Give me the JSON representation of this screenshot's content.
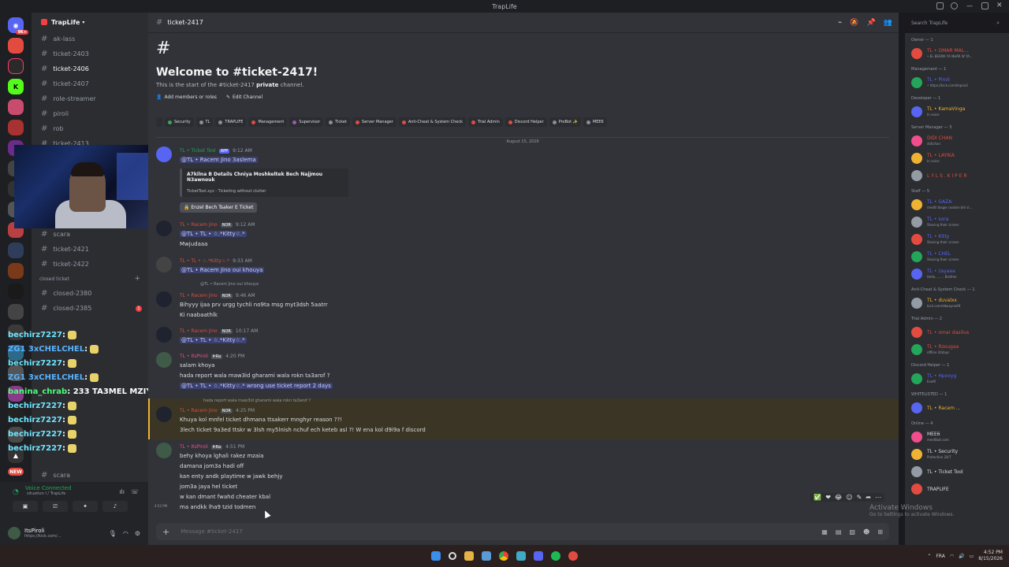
{
  "window": {
    "title": "TrapLife"
  },
  "server": {
    "name": "TrapLife"
  },
  "channels": [
    {
      "name": "ak-lass",
      "active": false,
      "badge": ""
    },
    {
      "name": "ticket-2403",
      "active": false,
      "badge": ""
    },
    {
      "name": "ticket-2406",
      "active": true,
      "badge": ""
    },
    {
      "name": "ticket-2407",
      "active": false,
      "badge": ""
    },
    {
      "name": "role-streamer",
      "active": false,
      "badge": ""
    },
    {
      "name": "piroli",
      "active": false,
      "badge": ""
    },
    {
      "name": "rob",
      "active": false,
      "badge": ""
    },
    {
      "name": "ticket-2413",
      "active": false,
      "badge": ""
    }
  ],
  "channels2": [
    {
      "name": "scara",
      "badge": ""
    },
    {
      "name": "ticket-2421",
      "badge": ""
    },
    {
      "name": "ticket-2422",
      "badge": ""
    }
  ],
  "category_closed": "closed ticket",
  "closed": [
    {
      "name": "closed-2380",
      "badge": ""
    },
    {
      "name": "closed-2385",
      "badge": "1"
    }
  ],
  "channels_bottom": [
    {
      "name": "scara"
    }
  ],
  "guild_badges": {
    "top": "9K+",
    "new": "NEW"
  },
  "stream_chat": [
    {
      "user": "bechirz7227",
      "color": "#6ee6ff",
      "text": ":"
    },
    {
      "user": "ZG1 3xCHELCHEL",
      "color": "#58b4ff",
      "text": ":"
    },
    {
      "user": "bechirz7227",
      "color": "#6ee6ff",
      "text": ":"
    },
    {
      "user": "ZG1 3xCHELCHEL",
      "color": "#58b4ff",
      "text": ":"
    },
    {
      "user": "banina_chrab",
      "color": "#4bff7b",
      "text": ": 233 TA3MEL MZIYA"
    },
    {
      "user": "bechirz7227",
      "color": "#6ee6ff",
      "text": ":"
    },
    {
      "user": "bechirz7227",
      "color": "#6ee6ff",
      "text": ":"
    },
    {
      "user": "bechirz7227",
      "color": "#6ee6ff",
      "text": ":"
    },
    {
      "user": "bechirz7227",
      "color": "#6ee6ff",
      "text": ":"
    }
  ],
  "voice": {
    "title": "Voice Connected",
    "channel": "situation I / TrapLife"
  },
  "user": {
    "name": "ItsPiroli",
    "status": "https://kick.com/..."
  },
  "header": {
    "channel": "ticket-2417",
    "search_placeholder": "Search TrapLife"
  },
  "welcome": {
    "title": "Welcome to #ticket-2417!",
    "sub_prefix": "This is the start of the #ticket-2417 ",
    "sub_private": "private",
    "sub_suffix": " channel.",
    "add_members": "Add members or roles",
    "edit_channel": "Edit Channel"
  },
  "roles": [
    {
      "label": "Security",
      "color": "#3ba55c"
    },
    {
      "label": "TL",
      "color": "#8b8f96"
    },
    {
      "label": "TRAPLIFE",
      "color": "#8b8f96"
    },
    {
      "label": "Management",
      "color": "#e34b40"
    },
    {
      "label": "Supervisor",
      "color": "#9b59b6"
    },
    {
      "label": "Ticket",
      "color": "#8b8f96"
    },
    {
      "label": "Server Manager",
      "color": "#e34b40"
    },
    {
      "label": "Anti-Cheat & System Check",
      "color": "#e34b40"
    },
    {
      "label": "Trial Admin",
      "color": "#e34b40"
    },
    {
      "label": "Discord Helper",
      "color": "#e34b40"
    },
    {
      "label": "ProBot ✨",
      "color": "#8b8f96"
    },
    {
      "label": "MEE6",
      "color": "#8b8f96"
    }
  ],
  "date_divider": "August 15, 2026",
  "messages": [
    {
      "name": "TL • Ticket Tool",
      "tag": "APP",
      "time": "9:12 AM",
      "color": "green",
      "lines": [
        "@TL • Racem Jino 3aslema"
      ]
    },
    {
      "name": "TL • Racem Jino",
      "tag": "NOR",
      "time": "9:12 AM",
      "color": "red",
      "lines": [
        "@TL • TL • ☆.*Kitty☆.*",
        "Mwjudaaa"
      ]
    },
    {
      "name": "TL • TL • ☆.*Kitty☆.*",
      "tag": "",
      "time": "9:33 AM",
      "color": "red",
      "lines": [
        "@TL • Racem Jino oui khouya"
      ]
    },
    {
      "name": "TL • Racem Jino",
      "tag": "NOR",
      "time": "9:46 AM",
      "color": "red",
      "lines": [
        "Bihyyy ijaa prv urgg tychli no9ta msg myt3dsh 5aatrr",
        "Ki naabaathlk"
      ]
    },
    {
      "name": "TL • Racem Jino",
      "tag": "NOR",
      "time": "10:17 AM",
      "color": "red",
      "lines": [
        "@TL • TL • ☆.*Kitty☆.*"
      ]
    },
    {
      "name": "TL • ItsPiroli",
      "tag": "ᐈRa",
      "time": "4:20 PM",
      "color": "pink",
      "lines": [
        "salam khoya",
        "hada report wala maw3id gharami wala rokn ta3arof ?",
        "@TL • TL • ☆.*Kitty☆.* wrong use ticket report 2 days"
      ]
    },
    {
      "name": "TL • Racem Jino",
      "tag": "NOR",
      "time": "4:25 PM",
      "color": "red",
      "lines": [
        "Khuya kol mnfel ticket dhmana ttsakerr mnghyr reason ??!",
        "3lech ticket 9a3ed ttskr  w 3lsh my5lnish nchuf ech keteb asl ?! W ena kol d9i9a f discord"
      ]
    },
    {
      "name": "TL • ItsPiroli",
      "tag": "ᐈRa",
      "time": "4:51 PM",
      "color": "pink",
      "lines": [
        "behy khoya lghali rakez mzaia",
        "damana jom3a hadi off",
        "kan enty andk playtime w jawk behjy",
        "jom3a jaya hel ticket",
        "w kan dmant fwahd cheater kbal",
        "ma andkk lha9 tzid todmen"
      ]
    }
  ],
  "embed": {
    "title": "A7kilna B Details Chniya Moshkeltek Bech Najjmou N3awnouk",
    "footer": "TicketTool.xyz - Ticketing without clutter",
    "button": "Enzel Bech Tsaker E Ticket"
  },
  "reply_previews": [
    "@TL • Racem Jino oui khouya",
    "hada report wala maw3id gharami wala rokn ta3arof ?"
  ],
  "last_time": "4:52 PM",
  "composer_placeholder": "Message #ticket-2417",
  "member_groups": [
    {
      "title": "Owner — 1",
      "members": [
        {
          "name": "TL • OMAR MAL...",
          "status": "• EL BESMA YA NHAR W YA..."
        }
      ]
    },
    {
      "title": "Management — 1",
      "members": [
        {
          "name": "TL • Piroli",
          "status": "• https://kick.com/itspiroli"
        }
      ]
    },
    {
      "title": "Developer — 1",
      "members": [
        {
          "name": "TL • KamaVinga",
          "status": "In voice"
        }
      ]
    },
    {
      "title": "Server Manager — 3",
      "members": [
        {
          "name": "DIDI CHAN",
          "status": "didichan"
        },
        {
          "name": "TL • LAYIKA",
          "status": "In voice"
        },
        {
          "name": "L Y L S . K I P E R",
          "status": ""
        }
      ]
    },
    {
      "title": "Staff — 5",
      "members": [
        {
          "name": "TL • GAZA",
          "status": "medlil blagie rassker bih sl..."
        },
        {
          "name": "TL • sora",
          "status": "Sharing their screen"
        },
        {
          "name": "TL • Kitty",
          "status": "Sharing their screen"
        },
        {
          "name": "TL • CHEL",
          "status": "Sharing their screen"
        },
        {
          "name": "TL • zayaaa",
          "status": "Hello......... Brother"
        }
      ]
    },
    {
      "title": "Anti-Cheat & System Check — 1",
      "members": [
        {
          "name": "TL • duvalxx",
          "status": "kick.com/ddwayne69"
        }
      ]
    },
    {
      "title": "Trial Admin — 2",
      "members": [
        {
          "name": "TL • omar dasilva",
          "status": ""
        },
        {
          "name": "TL • Rzougaa",
          "status": "offline 24days"
        }
      ]
    },
    {
      "title": "Discord Helper — 1",
      "members": [
        {
          "name": "TL • Hpxxyg",
          "status": "EveM"
        }
      ]
    },
    {
      "title": "WHITELISTED — 1",
      "members": [
        {
          "name": "TL • Racem ...",
          "status": ""
        }
      ]
    },
    {
      "title": "Online — 4",
      "members": [
        {
          "name": "MEE6",
          "status": "mee6bot.com"
        },
        {
          "name": "TL • Security",
          "status": "Protection 24/7"
        },
        {
          "name": "TL • Ticket Tool",
          "status": ""
        },
        {
          "name": "TRAPLIFE",
          "status": ""
        }
      ]
    }
  ],
  "watermark": {
    "title": "Activate Windows",
    "sub": "Go to Settings to activate Windows."
  },
  "taskbar": {
    "lang": "FRA",
    "time": "4:52 PM",
    "date": "8/15/2026"
  }
}
